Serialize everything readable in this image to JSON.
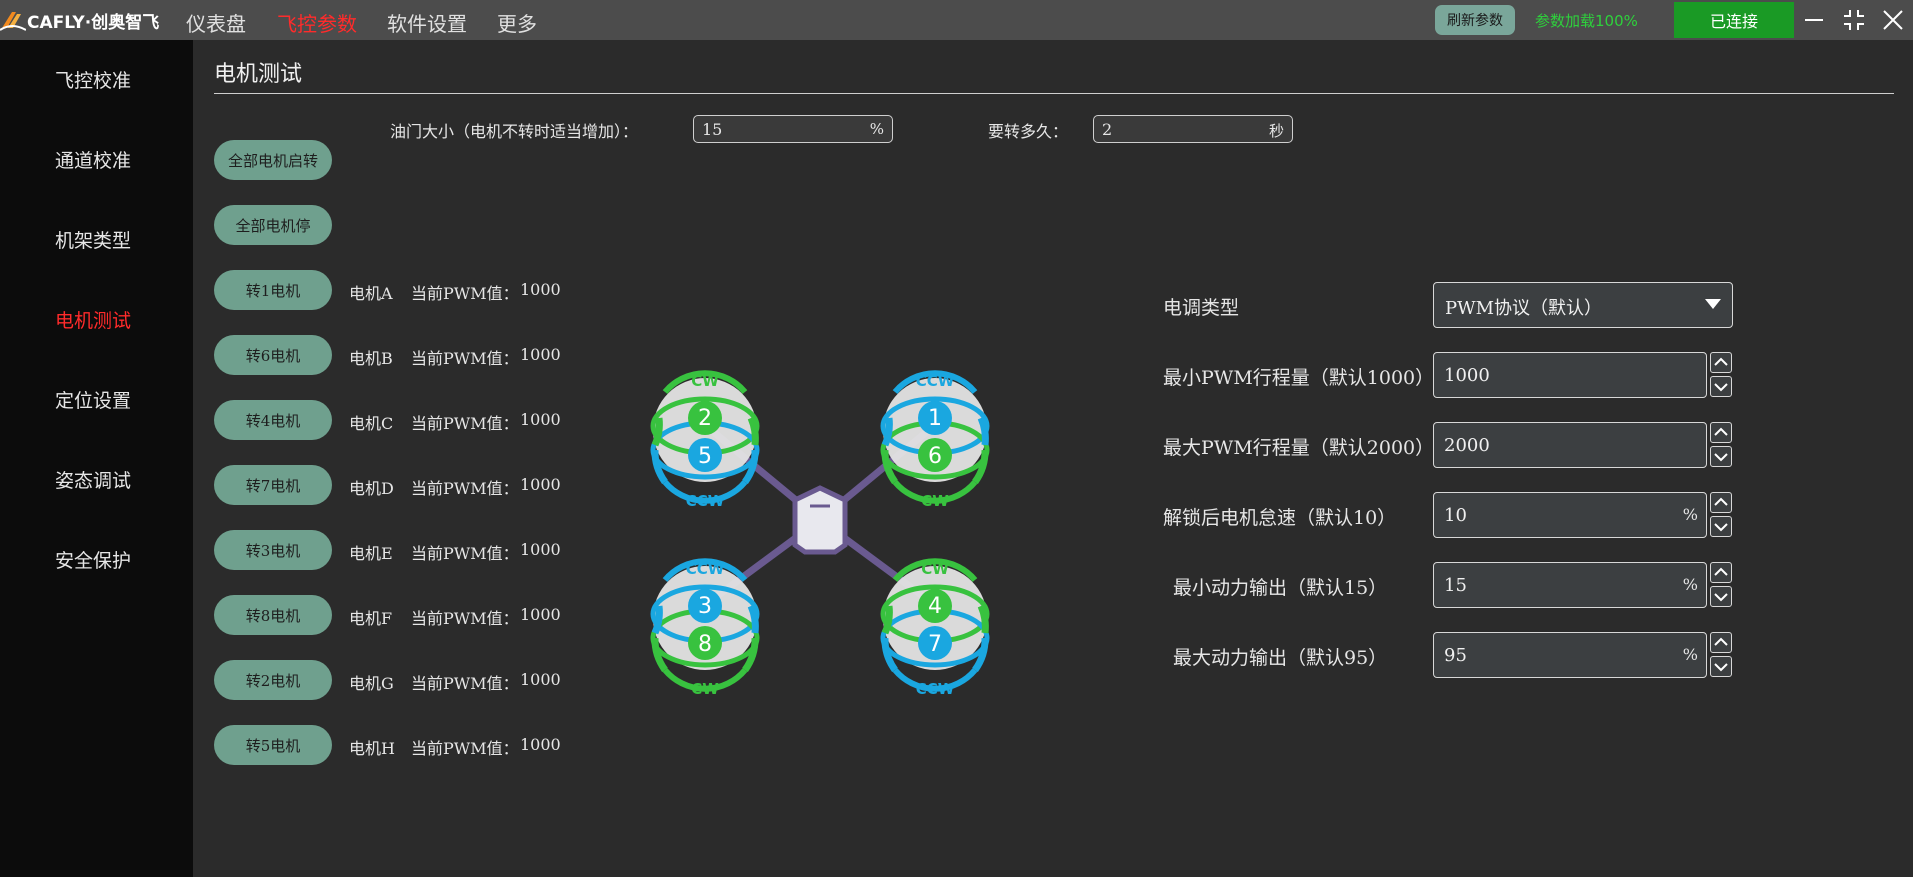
{
  "app": {
    "logo_text": "CAFLY·创奥智飞",
    "nav": [
      {
        "label": "仪表盘",
        "active": false
      },
      {
        "label": "飞控参数",
        "active": true
      },
      {
        "label": "软件设置",
        "active": false
      },
      {
        "label": "更多",
        "active": false
      }
    ],
    "refresh_label": "刷新参数",
    "load_status": "参数加载100%",
    "connect_label": "已连接",
    "colors": {
      "active_red": "#ff2b2b",
      "green_button": "#6fa08e",
      "connected_green": "#1a9a25",
      "cw_green": "#38c23f",
      "ccw_blue": "#1aa7e0"
    }
  },
  "sidebar": {
    "items": [
      {
        "label": "飞控校准",
        "active": false
      },
      {
        "label": "通道校准",
        "active": false
      },
      {
        "label": "机架类型",
        "active": false
      },
      {
        "label": "电机测试",
        "active": true
      },
      {
        "label": "定位设置",
        "active": false
      },
      {
        "label": "姿态调试",
        "active": false
      },
      {
        "label": "安全保护",
        "active": false
      }
    ]
  },
  "main": {
    "title": "电机测试",
    "throttle_label": "油门大小（电机不转时适当增加）：",
    "throttle_value": "15",
    "throttle_unit": "%",
    "duration_label": "要转多久：",
    "duration_value": "2",
    "duration_unit": "秒",
    "start_all_label": "全部电机启转",
    "stop_all_label": "全部电机停",
    "pwm_prefix": "当前PWM值：",
    "motors": [
      {
        "button": "转1电机",
        "name": "电机A",
        "pwm": "1000"
      },
      {
        "button": "转6电机",
        "name": "电机B",
        "pwm": "1000"
      },
      {
        "button": "转4电机",
        "name": "电机C",
        "pwm": "1000"
      },
      {
        "button": "转7电机",
        "name": "电机D",
        "pwm": "1000"
      },
      {
        "button": "转3电机",
        "name": "电机E",
        "pwm": "1000"
      },
      {
        "button": "转8电机",
        "name": "电机F",
        "pwm": "1000"
      },
      {
        "button": "转2电机",
        "name": "电机G",
        "pwm": "1000"
      },
      {
        "button": "转5电机",
        "name": "电机H",
        "pwm": "1000"
      }
    ],
    "diagram": {
      "rotors": [
        {
          "top": "2",
          "bottom": "5",
          "top_dir": "CW",
          "bottom_dir": "CCW"
        },
        {
          "top": "1",
          "bottom": "6",
          "top_dir": "CCW",
          "bottom_dir": "CW"
        },
        {
          "top": "3",
          "bottom": "8",
          "top_dir": "CCW",
          "bottom_dir": "CW"
        },
        {
          "top": "4",
          "bottom": "7",
          "top_dir": "CW",
          "bottom_dir": "CCW"
        }
      ]
    }
  },
  "settings": {
    "esc_type_label": "电调类型",
    "esc_type_value": "PWM协议（默认）",
    "fields": [
      {
        "label": "最小PWM行程量（默认1000）",
        "value": "1000",
        "unit": ""
      },
      {
        "label": "最大PWM行程量（默认2000）",
        "value": "2000",
        "unit": ""
      },
      {
        "label": "解锁后电机怠速（默认10）",
        "value": "10",
        "unit": "%"
      },
      {
        "label": "最小动力输出（默认15）",
        "value": "15",
        "unit": "%"
      },
      {
        "label": "最大动力输出（默认95）",
        "value": "95",
        "unit": "%"
      }
    ]
  }
}
